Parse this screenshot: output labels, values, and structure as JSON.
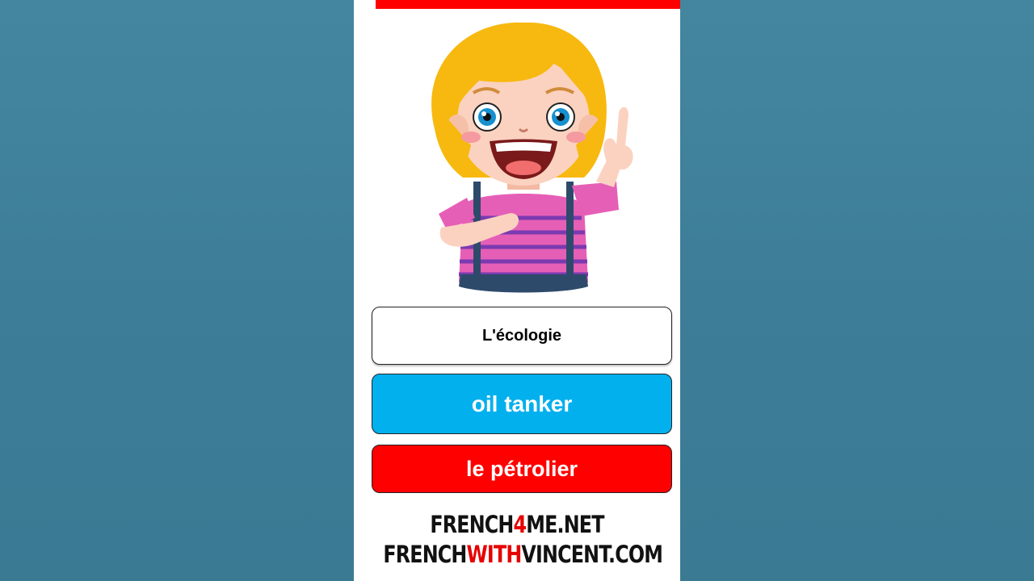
{
  "flashcard": {
    "term": "L'écologie",
    "english": "oil tanker",
    "french": "le pétrolier"
  },
  "branding": {
    "line1": {
      "pre": "FRENCH",
      "accent": "4",
      "post": "ME.NET"
    },
    "line2": {
      "pre": "FRENCH",
      "accent": "WITH",
      "post": "VINCENT.COM"
    }
  },
  "colors": {
    "accent_red": "#ff0000",
    "accent_blue": "#03b0ee",
    "background": "#3f7f99"
  },
  "illustration": {
    "icon": "pointing-girl-illustration"
  }
}
